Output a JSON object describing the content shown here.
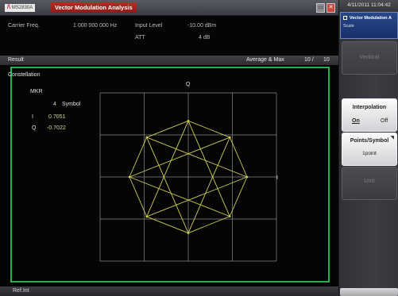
{
  "titlebar": {
    "brand": "MS2830A",
    "app_title": "Vector Modulation Analysis"
  },
  "params": {
    "carrier_freq_label": "Carrier Freq.",
    "carrier_freq_value": "1 000 000 000 Hz",
    "input_level_label": "Input Level",
    "input_level_value": "-10.00 dBm",
    "att_label": "ATT",
    "att_value": "4 dB"
  },
  "result_bar": {
    "label": "Result",
    "mode": "Average & Max",
    "count": "10 /",
    "total": "10"
  },
  "panel": {
    "title": "Constellation",
    "q_axis": "Q",
    "i_axis": "I"
  },
  "marker": {
    "label": "MKR",
    "symbol_number": "4",
    "symbol_label": "Symbol",
    "i_label": "I",
    "i_value": "0.7051",
    "q_label": "Q",
    "q_value": "-0.7022"
  },
  "ref_bar": {
    "label": "Ref.Int"
  },
  "side_panel": {
    "datetime": "4/11/2011 11:04:42",
    "menu_title": "Vector Modulation A",
    "menu_subtitle": "Scale",
    "keys": [
      {
        "label": "Vertical",
        "active": false
      },
      {
        "label": "Interpolation",
        "active": true,
        "option_on": "On",
        "option_off": "Off",
        "selected": "On"
      },
      {
        "label": "Points/Symbol",
        "active": true,
        "value": "1point"
      },
      {
        "label": "Unit",
        "active": false
      }
    ]
  },
  "colors": {
    "panel_border": "#22b14c",
    "trace": "#cfcf55",
    "grid": "#8a8a8a",
    "title_accent": "#b92a24",
    "menu_header": "#28478a"
  },
  "icons": [
    "close-icon",
    "restore-icon",
    "menu-icon"
  ],
  "chart_data": {
    "type": "scatter",
    "title": "",
    "xlabel": "I",
    "ylabel": "Q",
    "xlim": [
      -1.5,
      1.5
    ],
    "ylim": [
      -1.5,
      1.5
    ],
    "grid": true,
    "connected": true,
    "series": [
      {
        "points": [
          [
            1.0,
            0.0
          ],
          [
            0.7071,
            0.7071
          ],
          [
            0.0,
            1.0
          ],
          [
            -0.7071,
            0.7071
          ],
          [
            -1.0,
            0.0
          ],
          [
            -0.7071,
            -0.7071
          ],
          [
            0.0,
            -1.0
          ],
          [
            0.7051,
            -0.7022
          ]
        ]
      }
    ],
    "marker": {
      "symbol": 4,
      "I": 0.7051,
      "Q": -0.7022
    }
  }
}
